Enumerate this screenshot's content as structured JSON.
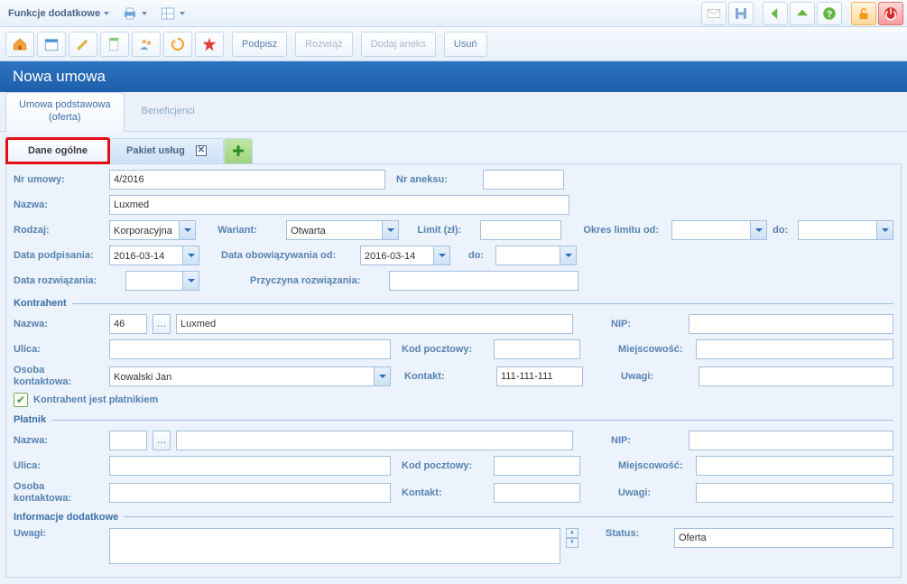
{
  "top_dropdown": "Funkcje dodatkowe",
  "page_title": "Nowa umowa",
  "tabs1": {
    "umowa": "Umowa podstawowa\n(oferta)",
    "beneficjenci": "Beneficjenci"
  },
  "tabs2": {
    "dane": "Dane ogólne",
    "pakiet": "Pakiet usług"
  },
  "buttons": {
    "podpisz": "Podpisz",
    "rozwiaz": "Rozwiąż",
    "aneks": "Dodaj aneks",
    "usun": "Usuń"
  },
  "labels": {
    "nr_umowy": "Nr umowy:",
    "nr_aneksu": "Nr aneksu:",
    "nazwa": "Nazwa:",
    "rodzaj": "Rodzaj:",
    "wariant": "Wariant:",
    "limit": "Limit (zł):",
    "okres_od": "Okres limitu od:",
    "do": "do:",
    "data_podpisania": "Data podpisania:",
    "data_obow_od": "Data obowiązywania od:",
    "data_rozwiazania": "Data rozwiązania:",
    "przyczyna": "Przyczyna rozwiązania:",
    "kontrahent": "Kontrahent",
    "platnik": "Płatnik",
    "info": "Informacje dodatkowe",
    "nazwa2": "Nazwa:",
    "nip": "NIP:",
    "ulica": "Ulica:",
    "kod": "Kod pocztowy:",
    "miejscowosc": "Miejscowość:",
    "osoba": "Osoba\nkontaktowa:",
    "kontakt": "Kontakt:",
    "uwagi": "Uwagi:",
    "status": "Status:",
    "chk": "Kontrahent jest płatnikiem"
  },
  "values": {
    "nr_umowy": "4/2016",
    "nazwa": "Luxmed",
    "rodzaj": "Korporacyjna",
    "wariant": "Otwarta",
    "data_podpisania": "2016-03-14",
    "data_obow_od": "2016-03-14",
    "k_id": "46",
    "k_nazwa": "Luxmed",
    "osoba": "Kowalski Jan",
    "kontakt": "111-111-111",
    "status": "Oferta"
  }
}
